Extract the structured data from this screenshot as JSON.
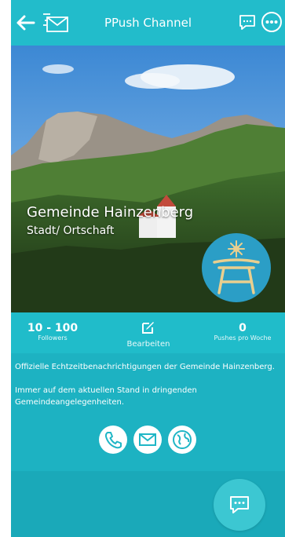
{
  "header": {
    "title": "PPush Channel",
    "icons": [
      "back-arrow-icon",
      "envelope-icon",
      "chat-icon",
      "more-options-icon"
    ]
  },
  "channel": {
    "name": "Gemeinde Hainzenberg",
    "type": "Stadt/ Ortschaft"
  },
  "stats": {
    "followers_value": "10 - 100",
    "followers_label": "Followers",
    "edit_label": "Bearbeiten",
    "pushes_value": "0",
    "pushes_label": "Pushes pro Woche"
  },
  "description": {
    "line1": "Offizielle Echtzeitbenachrichtigungen der Gemeinde Hainzenberg.",
    "line2": "Immer auf dem aktuellen Stand in dringenden Gemeindeangelegenheiten."
  },
  "contacts": [
    "phone-icon",
    "mail-icon",
    "web-globe-icon"
  ],
  "colors": {
    "primary": "#1fb6c6",
    "topbar": "#22bccb",
    "logo_bg": "#2b9ec6",
    "logo_symbol": "#e9cf8f"
  }
}
